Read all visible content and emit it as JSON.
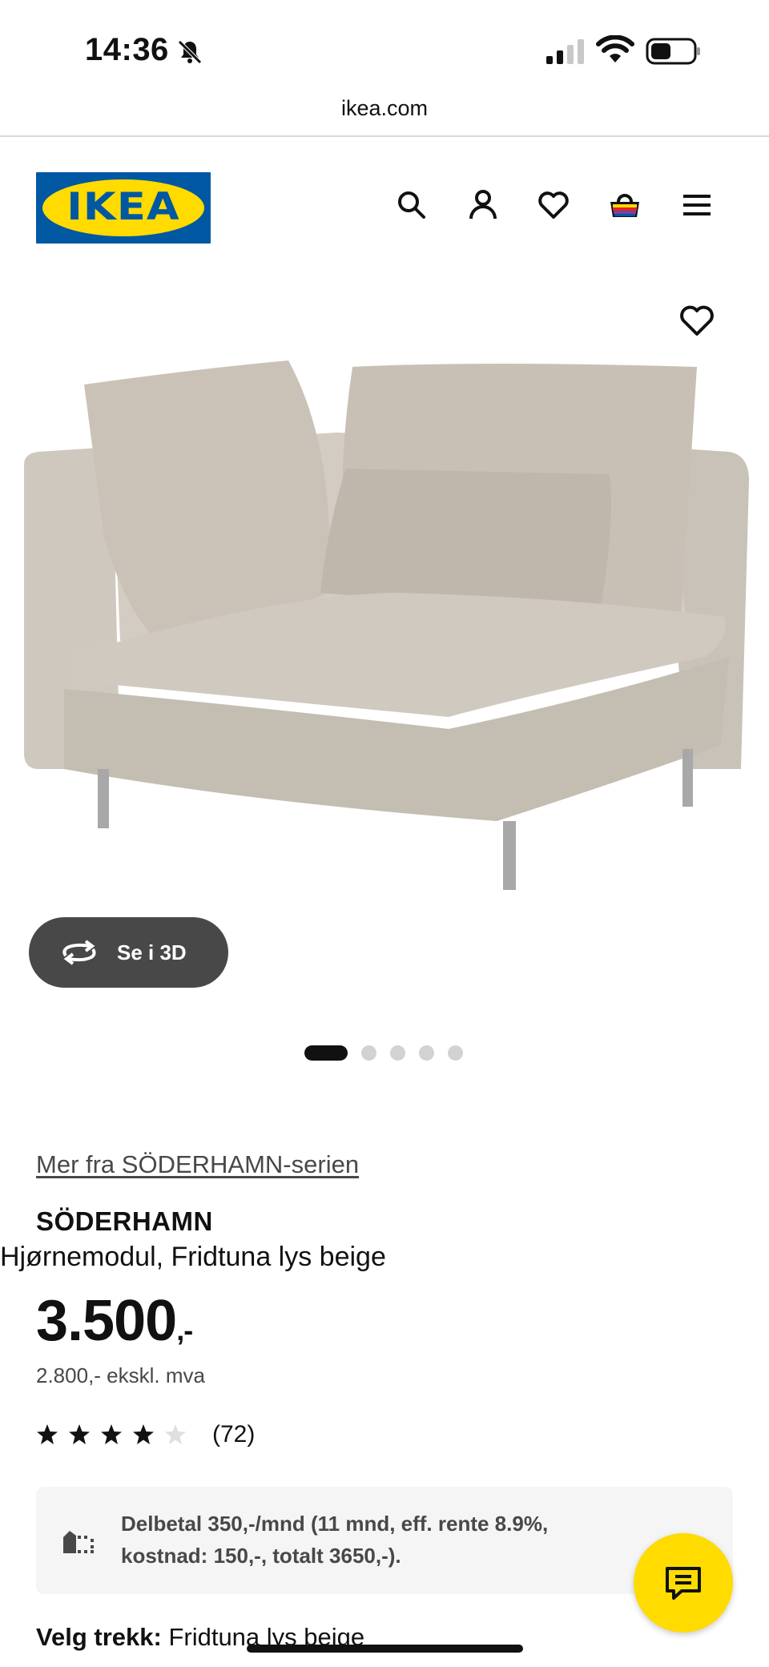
{
  "status_bar": {
    "time": "14:36",
    "icons": [
      "bell-slash-icon",
      "cellular-signal-icon",
      "wifi-icon",
      "battery-icon"
    ]
  },
  "browser": {
    "url": "ikea.com"
  },
  "header": {
    "logo_text": "IKEA",
    "icons": [
      "search-icon",
      "account-icon",
      "wishlist-heart-icon",
      "shopping-bag-icon",
      "menu-hamburger-icon"
    ]
  },
  "product": {
    "image_alt": "SÖDERHAMN corner section sofa module in light beige",
    "view_3d_label": "Se i 3D",
    "gallery": {
      "total": 5,
      "active_index": 0
    },
    "series_link": "Mer fra SÖDERHAMN-serien",
    "name": "SÖDERHAMN",
    "description": "Hjørnemodul, Fridtuna lys beige",
    "price_main": "3.500",
    "price_suffix": ",-",
    "price_ex_vat": "2.800,- ekskl. mva",
    "rating": {
      "value": 4,
      "max": 5,
      "count_label": "(72)"
    },
    "installment": {
      "text": "Delbetal 350,-/mnd (11 mnd, eff. rente 8.9%, kostnad: 150,-, totalt 3650,-)."
    },
    "cover_label": "Velg trekk:",
    "cover_value": "Fridtuna lys beige"
  },
  "colors": {
    "ikea_blue": "#0058a3",
    "ikea_yellow": "#ffdb00",
    "dark_button": "#484848"
  }
}
